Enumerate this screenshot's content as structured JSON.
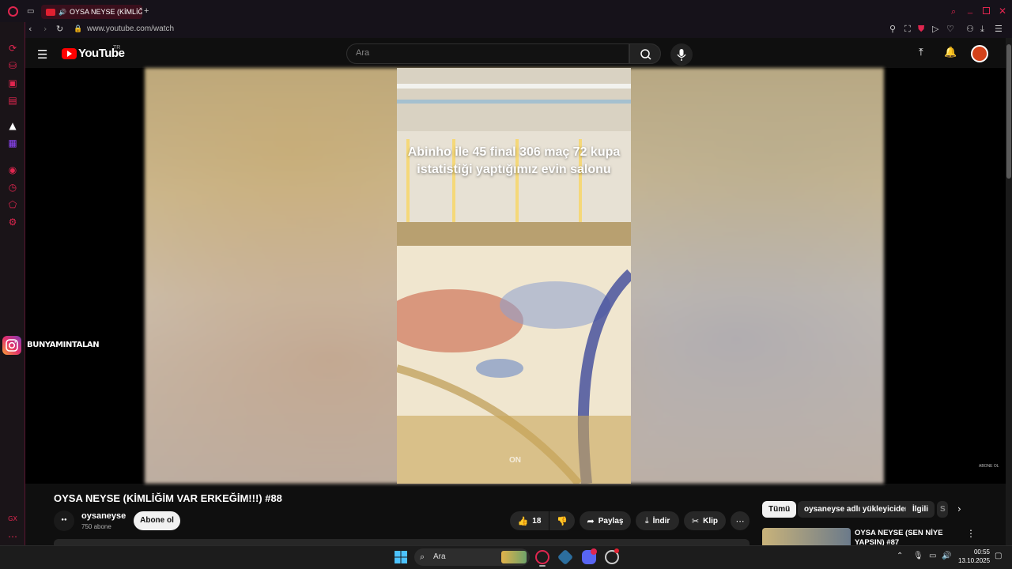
{
  "browser": {
    "tab_title": "OYSA NEYSE (KİMLİĞİ",
    "url": "www.youtube.com/watch"
  },
  "youtube": {
    "logo_text": "YouTube",
    "region": "TR",
    "search_placeholder": "Ara"
  },
  "video": {
    "overlay_text": "Abinho ile 45 final 306 maç 72 kupa istatistiği yaptığımız evin salonu",
    "watermark": "ON",
    "corner_mark": "ABONE OL",
    "title": "OYSA NEYSE (KİMLİĞİM VAR ERKEĞİM!!!) #88"
  },
  "streamer_overlay": {
    "instagram_handle": "BUNYAMINTALAN"
  },
  "channel": {
    "name": "oysaneyse",
    "subscribers": "750 abone",
    "subscribe_label": "Abone ol"
  },
  "actions": {
    "likes": "18",
    "share": "Paylaş",
    "download": "İndir",
    "clip": "Klip"
  },
  "chips": [
    "Tümü",
    "oysaneyse adlı yükleyiciden",
    "İlgili",
    "S"
  ],
  "recommendation": {
    "title": "OYSA NEYSE (SEN NİYE YAPSIN) #87"
  },
  "taskbar": {
    "search": "Ara",
    "time": "00:55",
    "date": "13.10.2025"
  },
  "colors": {
    "opera_accent": "#e0264f",
    "youtube_red": "#ff0000",
    "background": "#0f0f0f"
  }
}
